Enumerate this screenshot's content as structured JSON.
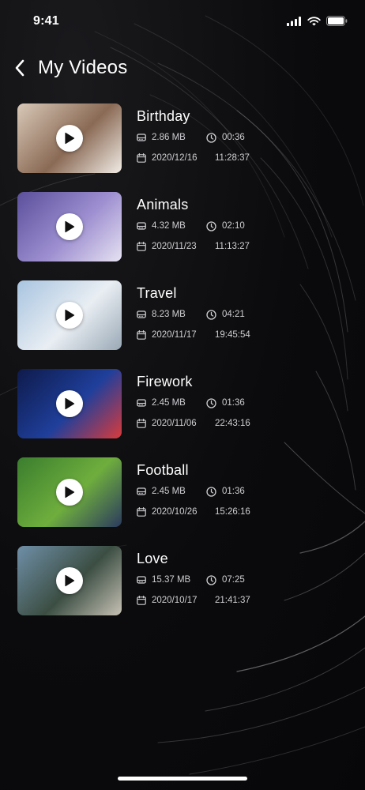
{
  "status_bar": {
    "time": "9:41"
  },
  "header": {
    "title": "My Videos"
  },
  "videos": [
    {
      "title": "Birthday",
      "size": "2.86 MB",
      "duration": "00:36",
      "date": "2020/12/16",
      "time": "11:28:37",
      "colors": [
        "#d9c9b8",
        "#8a6a55",
        "#f1ece6"
      ]
    },
    {
      "title": "Animals",
      "size": "4.32 MB",
      "duration": "02:10",
      "date": "2020/11/23",
      "time": "11:13:27",
      "colors": [
        "#5b4f9c",
        "#9d8fd0",
        "#e7e2f2"
      ]
    },
    {
      "title": "Travel",
      "size": "8.23 MB",
      "duration": "04:21",
      "date": "2020/11/17",
      "time": "19:45:54",
      "colors": [
        "#a8c4e0",
        "#e9eef3",
        "#9aa9b6"
      ]
    },
    {
      "title": "Firework",
      "size": "2.45 MB",
      "duration": "01:36",
      "date": "2020/11/06",
      "time": "22:43:16",
      "colors": [
        "#0e1a4a",
        "#1f3f9b",
        "#d93b3b"
      ]
    },
    {
      "title": "Football",
      "size": "2.45 MB",
      "duration": "01:36",
      "date": "2020/10/26",
      "time": "15:26:16",
      "colors": [
        "#3a7d2e",
        "#6fae3d",
        "#2b3a5e"
      ]
    },
    {
      "title": "Love",
      "size": "15.37 MB",
      "duration": "07:25",
      "date": "2020/10/17",
      "time": "21:41:37",
      "colors": [
        "#6f8fa8",
        "#3c4e43",
        "#c7c2b5"
      ]
    }
  ]
}
